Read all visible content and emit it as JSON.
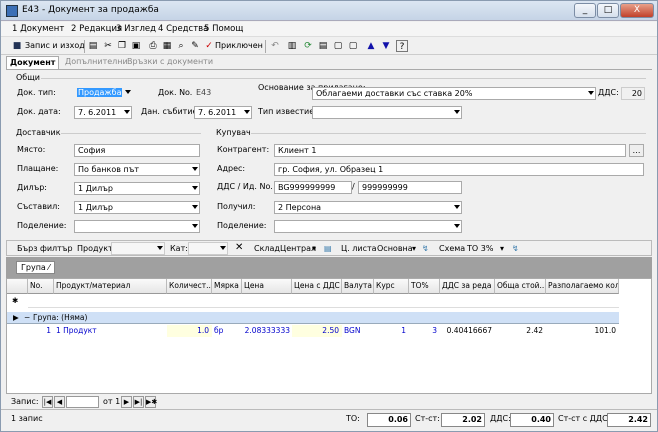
{
  "window": {
    "title": "E43 - Документ за продажба",
    "min": "_",
    "max": "□",
    "close": "X"
  },
  "menu": [
    "1 Документ",
    "2 Редакция",
    "3 Изглед",
    "4 Средства",
    "5 Помощ"
  ],
  "toolbar": {
    "save": "Запис и изход",
    "post": "Приключен"
  },
  "tabs": [
    "Документ",
    "Допълнителни",
    "Връзки с документи"
  ],
  "general": {
    "section": "Общи",
    "doc_type_label": "Док. тип:",
    "doc_type": "Продажба",
    "doc_no_label": "Док. No.",
    "doc_no": "E43",
    "basis_label": "Основание за прилагане:",
    "basis": "Облагаеми доставки със ставка 20%",
    "vat_label": "ДДС:",
    "vat": "20",
    "doc_date_label": "Док. дата:",
    "doc_date": "7. 6.2011",
    "event_date_label": "Дан. събитие:",
    "event_date": "7. 6.2011",
    "notice_label": "Тип известие:",
    "notice": ""
  },
  "supplier": {
    "section": "Доставчик",
    "place_label": "Място:",
    "place": "София",
    "payment_label": "Плащане:",
    "payment": "По банков път",
    "dealer_label": "Дилър:",
    "dealer": "1 Дилър",
    "compiler_label": "Съставил:",
    "compiler": "1 Дилър",
    "division_label": "Поделение:",
    "division": ""
  },
  "buyer": {
    "section": "Купувач",
    "contractor_label": "Контрагент:",
    "contractor": "Клиент 1",
    "address_label": "Адрес:",
    "address": "гр. София, ул. Образец 1",
    "vatid_label": "ДДС / Ид. No.",
    "vatno": "BG999999999",
    "idno": "999999999",
    "slash": "/",
    "received_label": "Получил:",
    "received": "2 Персона",
    "division_label": "Поделение:",
    "division": ""
  },
  "filter": {
    "quick": "Бърз филтър",
    "product": "Продукт:",
    "cat": "Кат:",
    "warehouse": "Склад",
    "warehouse_val": "Централ",
    "pricelist": "Ц. листа",
    "pricelist_val": "Основна",
    "scheme": "Схема",
    "scheme_val": "ТО 3%"
  },
  "group_chip": "Група",
  "grid": {
    "columns": [
      "No.",
      "Продукт/материал",
      "Количест...",
      "Мярка",
      "Цена",
      "Цена с ДДС",
      "Валута",
      "Курс",
      "ТО%",
      "ДДС за реда",
      "Обща стой...",
      "Разполагаемо кол."
    ],
    "group_row": "Група: (Няма)",
    "rows": [
      {
        "no": "1",
        "product": "1 Продукт",
        "qty": "1.0",
        "unit": "бр",
        "price": "2.08333333",
        "price_vat": "2.50",
        "currency": "BGN",
        "rate": "1",
        "to": "3",
        "vat_row": "0.40416667",
        "total": "2.42",
        "available": "101.0"
      }
    ]
  },
  "nav": {
    "record": "Запис:",
    "of": "от 1"
  },
  "status": {
    "records": "1 запис",
    "to_label": "ТО:",
    "to": "0.06",
    "cost_label": "Ст-ст:",
    "cost": "2.02",
    "vat_label": "ДДС:",
    "vat": "0.40",
    "costvat_label": "Ст-ст с ДДС:",
    "costvat": "2.42"
  }
}
